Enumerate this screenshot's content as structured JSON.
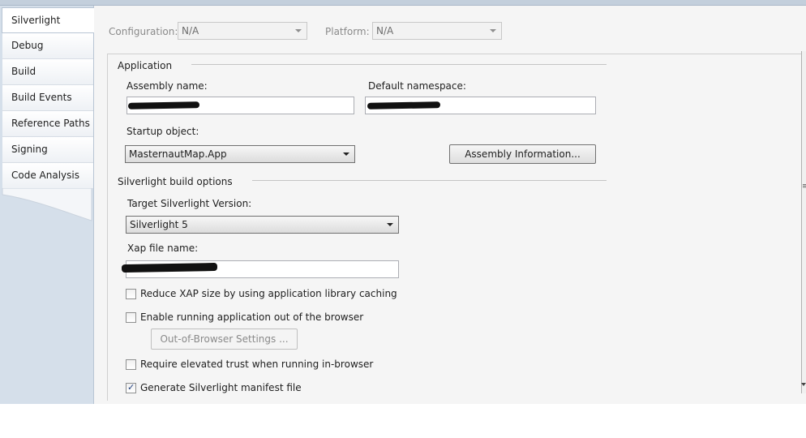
{
  "tabs": [
    {
      "label": "Silverlight",
      "active": true
    },
    {
      "label": "Debug"
    },
    {
      "label": "Build"
    },
    {
      "label": "Build Events"
    },
    {
      "label": "Reference Paths"
    },
    {
      "label": "Signing"
    },
    {
      "label": "Code Analysis"
    }
  ],
  "toolbar": {
    "configuration_label": "Configuration:",
    "configuration_value": "N/A",
    "platform_label": "Platform:",
    "platform_value": "N/A"
  },
  "application": {
    "group_label": "Application",
    "assembly_name_label": "Assembly name:",
    "default_namespace_label": "Default namespace:",
    "startup_object_label": "Startup object:",
    "startup_object_value": "MasternautMap.App",
    "assembly_info_button": "Assembly Information..."
  },
  "build_options": {
    "group_label": "Silverlight build options",
    "target_version_label": "Target Silverlight Version:",
    "target_version_value": "Silverlight 5",
    "xap_file_label": "Xap file name:",
    "reduce_xap_label": "Reduce XAP size by using application library caching",
    "reduce_xap_checked": false,
    "out_of_browser_label": "Enable running application out of the browser",
    "out_of_browser_checked": false,
    "oob_settings_button": "Out-of-Browser Settings ...",
    "elevated_trust_label": "Require elevated trust when running in-browser",
    "elevated_trust_checked": false,
    "manifest_label": "Generate Silverlight manifest file",
    "manifest_checked": true
  },
  "icons": {
    "check": "checkmark-icon",
    "dropdown": "chevron-down-icon"
  },
  "colors": {
    "tab_background": "#d5dfea",
    "pane_background": "#f5f5f5"
  }
}
